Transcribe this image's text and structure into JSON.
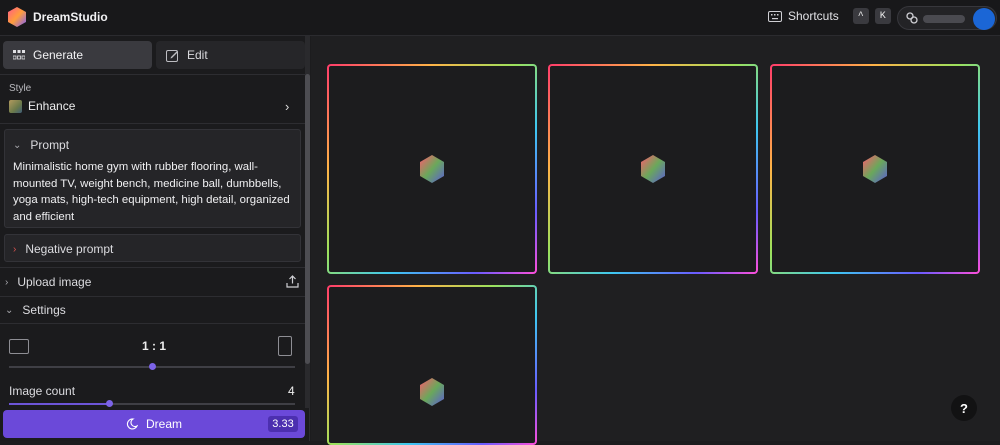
{
  "app": {
    "name": "DreamStudio"
  },
  "header": {
    "shortcuts_label": "Shortcuts",
    "shortcut_keys": [
      "^",
      "K"
    ]
  },
  "sidebar": {
    "tabs": [
      {
        "label": "Generate",
        "icon": "grid-icon",
        "active": true
      },
      {
        "label": "Edit",
        "icon": "edit-icon",
        "active": false
      }
    ],
    "style": {
      "label": "Style",
      "value": "Enhance"
    },
    "prompt": {
      "label": "Prompt",
      "text": "Minimalistic home gym with rubber flooring, wall-mounted TV, weight bench, medicine ball, dumbbells, yoga mats, high-tech equipment, high detail, organized and efficient"
    },
    "negative_prompt": {
      "label": "Negative prompt"
    },
    "upload_image": {
      "label": "Upload image"
    },
    "settings": {
      "label": "Settings",
      "aspect_ratio": "1 : 1",
      "aspect_ratio_position": 0.5,
      "image_count_label": "Image count",
      "image_count": "4",
      "image_count_position": 0.35
    },
    "dream_button": {
      "label": "Dream",
      "cost": "3.33"
    }
  },
  "canvas": {
    "image_count": 4,
    "loading_icon": "hexagon-icon"
  },
  "help": {
    "label": "?"
  },
  "colors": {
    "accent": "#6b49d9",
    "avatar": "#1b66d6",
    "negative_chevron": "#d9534f"
  }
}
